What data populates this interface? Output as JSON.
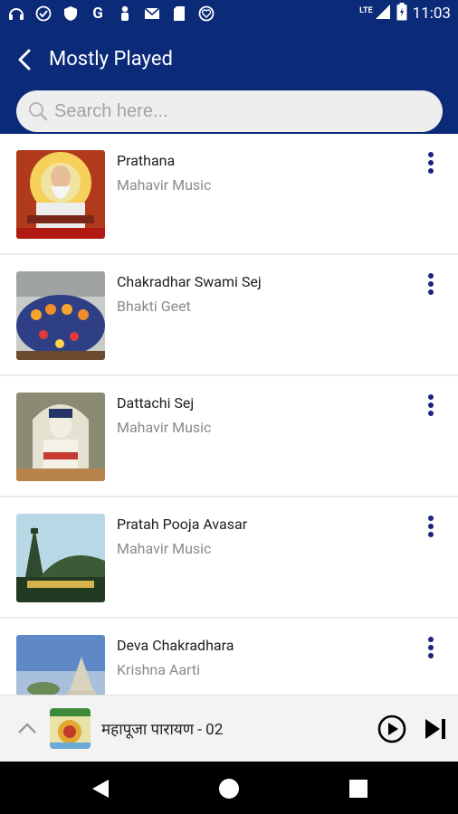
{
  "status_bar": {
    "time": "11:03",
    "network": "LTE"
  },
  "header": {
    "title": "Mostly Played"
  },
  "search": {
    "placeholder": "Search here..."
  },
  "songs": [
    {
      "title": "Prathana",
      "artist": "Mahavir Music"
    },
    {
      "title": "Chakradhar Swami Sej",
      "artist": "Bhakti Geet"
    },
    {
      "title": "Dattachi Sej",
      "artist": "Mahavir Music"
    },
    {
      "title": "Pratah Pooja Avasar",
      "artist": "Mahavir Music"
    },
    {
      "title": "Deva Chakradhara",
      "artist": "Krishna Aarti"
    }
  ],
  "player": {
    "now_playing": "महापूजा पारायण - 02"
  },
  "colors": {
    "primary": "#0b2a78",
    "accent": "#1a237e"
  }
}
